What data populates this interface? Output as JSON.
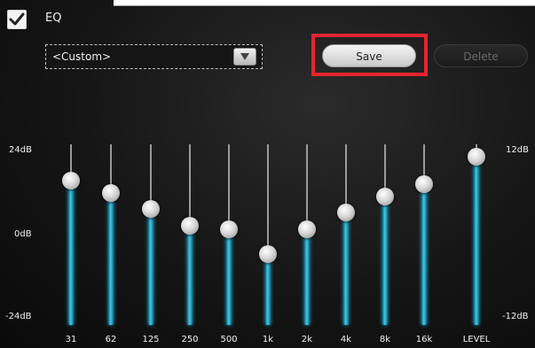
{
  "header": {
    "eq_enabled": true,
    "eq_label": "EQ"
  },
  "preset": {
    "selected": "<Custom>"
  },
  "buttons": {
    "save_label": "Save",
    "delete_label": "Delete",
    "save_highlighted": true,
    "delete_enabled": false
  },
  "scale": {
    "left_top": "24dB",
    "left_mid": "0dB",
    "left_bottom": "-24dB",
    "right_top": "12dB",
    "right_bottom": "-12dB"
  },
  "bands": [
    {
      "label": "31",
      "level": 0.84
    },
    {
      "label": "62",
      "level": 0.77
    },
    {
      "label": "125",
      "level": 0.68
    },
    {
      "label": "250",
      "level": 0.59
    },
    {
      "label": "500",
      "level": 0.57
    },
    {
      "label": "1k",
      "level": 0.43
    },
    {
      "label": "2k",
      "level": 0.57
    },
    {
      "label": "4k",
      "level": 0.66
    },
    {
      "label": "8k",
      "level": 0.75
    },
    {
      "label": "16k",
      "level": 0.82
    },
    {
      "label": "LEVEL",
      "level": 0.97
    }
  ],
  "colors": {
    "highlight": "#e32530",
    "slider_fill": "#49c6e6",
    "background": "#151515"
  }
}
